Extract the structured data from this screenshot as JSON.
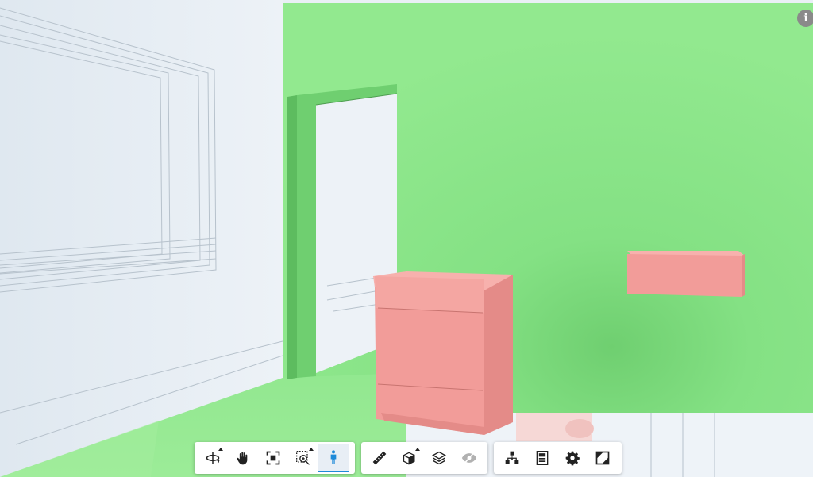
{
  "viewer": {
    "info_label": "i",
    "colors": {
      "wall_highlight": "#8fe68d",
      "cabinet_highlight": "#f29c99",
      "ghosted": "#e9f0f6",
      "toolbar_active": "#1f8ad8"
    }
  },
  "toolbar": {
    "navigation": [
      {
        "icon": "orbit-icon",
        "active": false,
        "flyout": true
      },
      {
        "icon": "pan-icon",
        "active": false,
        "flyout": false
      },
      {
        "icon": "fit-to-view-icon",
        "active": false,
        "flyout": false
      },
      {
        "icon": "zoom-window-icon",
        "active": false,
        "flyout": true
      },
      {
        "icon": "first-person-icon",
        "active": true,
        "flyout": false
      }
    ],
    "model": [
      {
        "icon": "measure-icon",
        "active": false,
        "flyout": false
      },
      {
        "icon": "section-box-icon",
        "active": false,
        "flyout": true
      },
      {
        "icon": "layers-icon",
        "active": false,
        "flyout": false
      },
      {
        "icon": "hide-eye-icon",
        "active": false,
        "flyout": false,
        "disabled": true
      }
    ],
    "settings": [
      {
        "icon": "model-browser-icon",
        "active": false,
        "flyout": false
      },
      {
        "icon": "properties-icon",
        "active": false,
        "flyout": false
      },
      {
        "icon": "settings-gear-icon",
        "active": false,
        "flyout": false
      },
      {
        "icon": "fullscreen-icon",
        "active": false,
        "flyout": false
      }
    ]
  }
}
